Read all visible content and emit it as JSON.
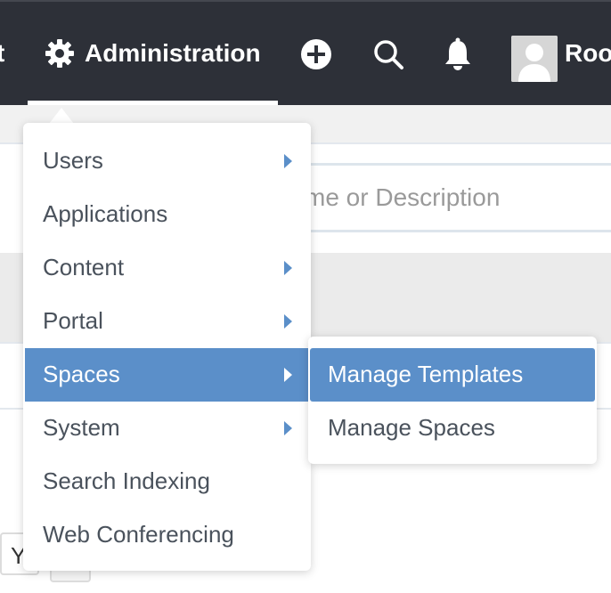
{
  "topbar": {
    "cut_label": "t",
    "admin_label": "Administration",
    "user_name": "Roo"
  },
  "search": {
    "placeholder": "me or Description"
  },
  "background": {
    "hint_char": "Y"
  },
  "admin_menu": {
    "items": [
      {
        "label": "Users",
        "has_submenu": true
      },
      {
        "label": "Applications",
        "has_submenu": false
      },
      {
        "label": "Content",
        "has_submenu": true
      },
      {
        "label": "Portal",
        "has_submenu": true
      },
      {
        "label": "Spaces",
        "has_submenu": true,
        "active": true
      },
      {
        "label": "System",
        "has_submenu": true
      },
      {
        "label": "Search Indexing",
        "has_submenu": false
      },
      {
        "label": "Web Conferencing",
        "has_submenu": false
      }
    ]
  },
  "spaces_submenu": {
    "items": [
      {
        "label": "Manage Templates",
        "active": true
      },
      {
        "label": "Manage Spaces",
        "active": false
      }
    ]
  },
  "colors": {
    "topbar_bg": "#2d3038",
    "accent": "#5b8fc9",
    "menu_text": "#4a525c"
  },
  "icons": {
    "admin": "gear-icon",
    "add": "plus-circle-icon",
    "search": "search-icon",
    "notifications": "bell-icon",
    "user": "avatar-placeholder-icon",
    "submenu_indicator": "caret-right-icon"
  }
}
